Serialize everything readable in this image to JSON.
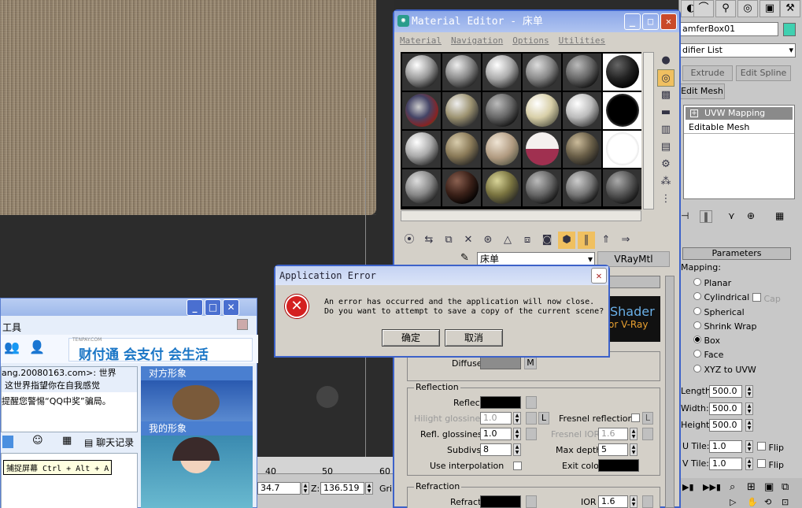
{
  "material_editor": {
    "title": "Material Editor - 床单",
    "menu": [
      "Material",
      "Navigation",
      "Options",
      "Utilities"
    ],
    "material_name": "床单",
    "material_type": "VRayMtl",
    "shader_banner": {
      "line1": "Shader",
      "line2": "or V-Ray"
    },
    "diffuse": {
      "label": "Diffuse",
      "map_button": "M"
    },
    "reflection": {
      "group_label": "Reflection",
      "reflect_label": "Reflect",
      "hilight_label": "Hilight glossiness",
      "hilight_value": "1.0",
      "lock_label": "L",
      "fresnel_label": "Fresnel reflections",
      "fresnel_lock": "L",
      "refl_gloss_label": "Refl. glossiness",
      "refl_gloss_value": "1.0",
      "fresnel_ior_label": "Fresnel IOR",
      "fresnel_ior_value": "1.6",
      "subdivs_label": "Subdivs",
      "subdivs_value": "8",
      "max_depth_label": "Max depth",
      "max_depth_value": "5",
      "interp_label": "Use interpolation",
      "exit_color_label": "Exit color"
    },
    "refraction": {
      "group_label": "Refraction",
      "refract_label": "Refract",
      "ior_label": "IOR",
      "ior_value": "1.6"
    }
  },
  "error_dialog": {
    "title": "Application Error",
    "line1": "An error has occurred and the application will now close.",
    "line2": "Do you want to attempt to save a copy of the current scene?",
    "ok_label": "确定",
    "cancel_label": "取消"
  },
  "command_panel": {
    "object_name": "amferBox01",
    "object_color": "#3fd0b0",
    "modifier_list": "difier List",
    "buttons": [
      "Extrude",
      "Edit Spline",
      "Edit Mesh"
    ],
    "stack": [
      "UVW Mapping",
      "Editable Mesh"
    ],
    "parameters_title": "Parameters",
    "mapping_label": "Mapping:",
    "mapping_options": [
      {
        "label": "Planar",
        "on": false
      },
      {
        "label": "Cylindrical",
        "on": false
      },
      {
        "label": "Spherical",
        "on": false
      },
      {
        "label": "Shrink Wrap",
        "on": false
      },
      {
        "label": "Box",
        "on": true
      },
      {
        "label": "Face",
        "on": false
      },
      {
        "label": "XYZ to UVW",
        "on": false
      }
    ],
    "cap_label": "Cap",
    "length_label": "Length:",
    "length_value": "500.0",
    "width_label": "Width:",
    "width_value": "500.0",
    "height_label": "Height:",
    "height_value": "500.0",
    "utile_label": "U Tile:",
    "utile_value": "1.0",
    "vtile_label": "V Tile:",
    "vtile_value": "1.0",
    "flip_label": "Flip"
  },
  "qq_window": {
    "tools_label": "工具",
    "ad_text": "财付通 会支付 会生活",
    "ad_brand": "TENPAY.COM",
    "chat_lines": [
      "ang.20080163.com>: 世界",
      "这世界指望你在自我感觉",
      "提醒您警惕“QQ中奖”骗局。"
    ],
    "peer_label": "对方形象",
    "my_label": "我的形象",
    "history_label": "聊天记录",
    "screenshot_hint": "捕捉屏幕 Ctrl + Alt + A"
  },
  "viewport": {
    "ruler": [
      "40",
      "50",
      "60"
    ],
    "x_value": "34.7",
    "z_label": "Z:",
    "z_value": "136.519",
    "grid_label": "Gri"
  }
}
